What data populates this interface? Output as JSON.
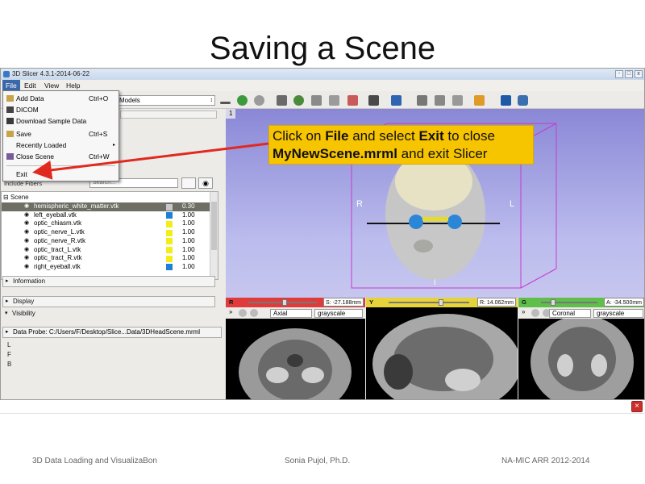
{
  "slide": {
    "title": "Saving a Scene",
    "footer_left": "3D Data Loading and VisualizaBon",
    "footer_center": "Sonia Pujol, Ph.D.",
    "footer_right": "NA-MIC ARR 2012-2014"
  },
  "window": {
    "title": "3D Slicer 4.3.1-2014-06-22",
    "buttons": [
      "-",
      "□",
      "x"
    ]
  },
  "menubar": [
    "File",
    "Edit",
    "View",
    "Help"
  ],
  "toolbar": {
    "module_selector": "Models"
  },
  "file_menu": {
    "items": [
      {
        "label": "Add Data",
        "shortcut": "Ctrl+O",
        "icon": "add-data-icon"
      },
      {
        "label": "DICOM",
        "shortcut": "",
        "icon": "dicom-icon"
      },
      {
        "label": "Download Sample Data",
        "shortcut": "",
        "icon": "download-icon"
      },
      {
        "label": "Save",
        "shortcut": "Ctrl+S",
        "icon": "save-icon"
      },
      {
        "label": "Recently Loaded",
        "shortcut": "",
        "submenu": "▸"
      },
      {
        "label": "Close Scene",
        "shortcut": "Ctrl+W",
        "icon": "close-scene-icon"
      },
      {
        "label": "Exit",
        "shortcut": ""
      }
    ]
  },
  "models_panel": {
    "filter_label": "Include Fibers",
    "filter_placeholder": "Search..."
  },
  "scene_tree": {
    "header": "Scene",
    "rows": [
      {
        "name": "hemispheric_white_matter.vtk",
        "color": "#c8c8c8",
        "opacity": "0.30",
        "selected": true
      },
      {
        "name": "left_eyeball.vtk",
        "color": "#1e7fd8",
        "opacity": "1.00"
      },
      {
        "name": "optic_chiasm.vtk",
        "color": "#f2ee1a",
        "opacity": "1.00"
      },
      {
        "name": "optic_nerve_L.vtk",
        "color": "#f2ee1a",
        "opacity": "1.00"
      },
      {
        "name": "optic_nerve_R.vtk",
        "color": "#f2ee1a",
        "opacity": "1.00"
      },
      {
        "name": "optic_tract_L.vtk",
        "color": "#f2ee1a",
        "opacity": "1.00"
      },
      {
        "name": "optic_tract_R.vtk",
        "color": "#f2ee1a",
        "opacity": "1.00"
      },
      {
        "name": "right_eyeball.vtk",
        "color": "#1e7fd8",
        "opacity": "1.00"
      }
    ]
  },
  "sections": {
    "information": "Information",
    "display": "Display",
    "visibility": "Visibility"
  },
  "data_probe": "Data Probe: C:/Users/F/Desktop/Slice...Data/3DHeadScene.mrml",
  "lfb": [
    "L",
    "F",
    "B"
  ],
  "view3d": {
    "tab": "1",
    "orient_left": "R",
    "orient_right": "L",
    "orient_bottom": "I"
  },
  "instruction": {
    "line1_pre": "Click on ",
    "line1_file": "File",
    "line1_mid": " and select ",
    "line1_exit": "Exit",
    "line1_post": " to close",
    "line2_bold": "MyNewScene.mrml",
    "line2_post": " and exit Slicer"
  },
  "slices": [
    {
      "letter": "R",
      "color": "#e03b3b",
      "value": "S: -27.188mm",
      "orientation": "Axial",
      "lut": "grayscale"
    },
    {
      "letter": "Y",
      "color": "#e6d23a",
      "value": "R: 14.062mm",
      "orientation": "",
      "lut": ""
    },
    {
      "letter": "G",
      "color": "#5fbf4a",
      "value": "A: -34.500mm",
      "orientation": "Coronal",
      "lut": "grayscale"
    }
  ]
}
